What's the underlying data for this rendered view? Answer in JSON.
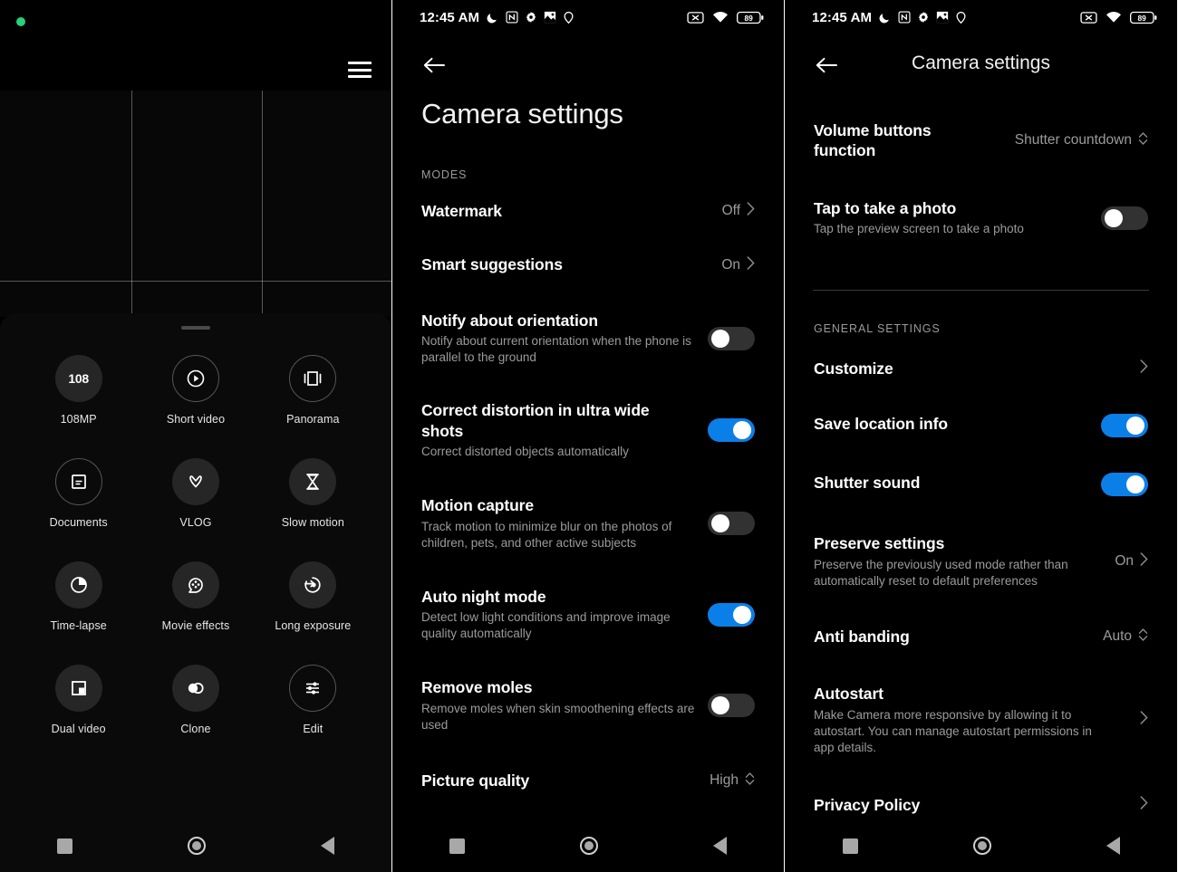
{
  "statusbar": {
    "time": "12:45 AM",
    "left_icons": [
      "dnd-moon-icon",
      "nfc-icon",
      "gear-icon",
      "gallery-icon",
      "location-icon"
    ],
    "right_icons": [
      "no-sim-icon",
      "wifi-icon"
    ],
    "battery_level": "89"
  },
  "navbar": {
    "recents": "recents-button",
    "home": "home-button",
    "back": "back-button"
  },
  "panel1": {
    "name": "camera-mode-picker",
    "privacy_indicator": "camera-in-use-dot",
    "menu_label": "menu-icon",
    "modes": [
      {
        "label": "108MP",
        "icon": "megapixel-icon",
        "style": "filled",
        "glyph": "108"
      },
      {
        "label": "Short video",
        "icon": "play-circle-icon",
        "style": "outline"
      },
      {
        "label": "Panorama",
        "icon": "panorama-icon",
        "style": "outline"
      },
      {
        "label": "Documents",
        "icon": "document-icon",
        "style": "outline"
      },
      {
        "label": "VLOG",
        "icon": "vlog-icon",
        "style": "filled"
      },
      {
        "label": "Slow motion",
        "icon": "hourglass-icon",
        "style": "filled"
      },
      {
        "label": "Time-lapse",
        "icon": "timelapse-icon",
        "style": "filled"
      },
      {
        "label": "Movie effects",
        "icon": "film-reel-icon",
        "style": "filled"
      },
      {
        "label": "Long exposure",
        "icon": "long-exposure-icon",
        "style": "filled"
      },
      {
        "label": "Dual video",
        "icon": "dual-video-icon",
        "style": "filled"
      },
      {
        "label": "Clone",
        "icon": "clone-icon",
        "style": "filled"
      },
      {
        "label": "Edit",
        "icon": "sliders-icon",
        "style": "outline"
      }
    ]
  },
  "panel2": {
    "title": "Camera settings",
    "back": "back-arrow-icon",
    "section_modes": "MODES",
    "items": [
      {
        "title": "Watermark",
        "sub": "",
        "control": "value",
        "value": "Off"
      },
      {
        "title": "Smart suggestions",
        "sub": "",
        "control": "value",
        "value": "On"
      },
      {
        "title": "Notify about orientation",
        "sub": "Notify about current orientation when the phone is parallel to the ground",
        "control": "toggle",
        "value": "off"
      },
      {
        "title": "Correct distortion in ultra wide shots",
        "sub": "Correct distorted objects automatically",
        "control": "toggle",
        "value": "on"
      },
      {
        "title": "Motion capture",
        "sub": "Track motion to minimize blur on the photos of children, pets, and other active subjects",
        "control": "toggle",
        "value": "off"
      },
      {
        "title": "Auto night mode",
        "sub": "Detect low light conditions and improve image quality automatically",
        "control": "toggle",
        "value": "on"
      },
      {
        "title": "Remove moles",
        "sub": "Remove moles when skin smoothening effects are used",
        "control": "toggle",
        "value": "off"
      },
      {
        "title": "Picture quality",
        "sub": "",
        "control": "stepper",
        "value": "High"
      }
    ]
  },
  "panel3": {
    "title": "Camera settings",
    "back": "back-arrow-icon",
    "section_general": "GENERAL SETTINGS",
    "items_top": [
      {
        "title": "Volume buttons function",
        "sub": "",
        "control": "stepper",
        "value": "Shutter countdown"
      },
      {
        "title": "Tap to take a photo",
        "sub": "Tap the preview screen to take a photo",
        "control": "toggle",
        "value": "off"
      }
    ],
    "items_general": [
      {
        "title": "Customize",
        "sub": "",
        "control": "chevron",
        "value": ""
      },
      {
        "title": "Save location info",
        "sub": "",
        "control": "toggle",
        "value": "on"
      },
      {
        "title": "Shutter sound",
        "sub": "",
        "control": "toggle",
        "value": "on"
      },
      {
        "title": "Preserve settings",
        "sub": "Preserve the previously used mode rather than automatically reset to default preferences",
        "control": "value",
        "value": "On"
      },
      {
        "title": "Anti banding",
        "sub": "",
        "control": "stepper",
        "value": "Auto"
      },
      {
        "title": "Autostart",
        "sub": "Make Camera more responsive by allowing it to autostart. You can manage autostart permissions in app details.",
        "control": "chevron",
        "value": ""
      },
      {
        "title": "Privacy Policy",
        "sub": "",
        "control": "chevron",
        "value": ""
      }
    ]
  },
  "colors": {
    "accent": "#0b7fe8",
    "toggle_off": "#323232",
    "privacy_dot": "#27d07a",
    "background": "#000000"
  }
}
